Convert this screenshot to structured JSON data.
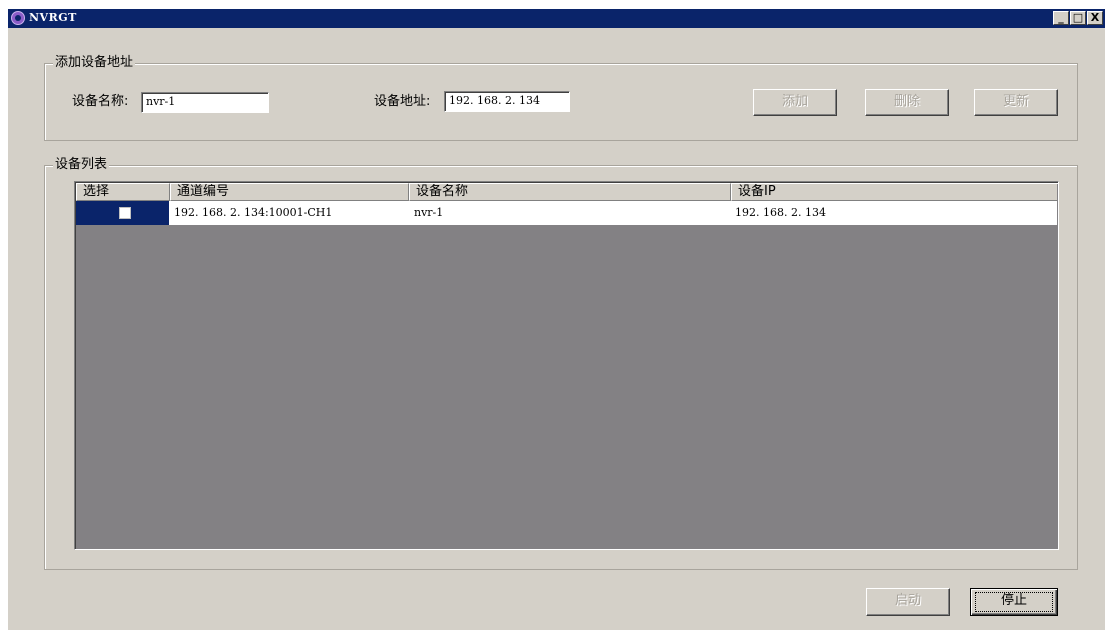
{
  "window": {
    "title": "NVRGT",
    "buttons": {
      "minimize": "_",
      "maximize": "□",
      "close": "X"
    }
  },
  "add_group": {
    "legend": "添加设备地址",
    "name_label": "设备名称:",
    "name_value": "nvr-1",
    "address_label": "设备地址:",
    "address_value": "192. 168. 2. 134",
    "add_label": "添加",
    "delete_label": "删除",
    "update_label": "更新"
  },
  "list_group": {
    "legend": "设备列表",
    "columns": [
      "选择",
      "通道编号",
      "设备名称",
      "设备IP"
    ],
    "rows": [
      {
        "checked": false,
        "channel": "192. 168. 2. 134:10001-CH1",
        "name": "nvr-1",
        "ip": "192. 168. 2. 134"
      }
    ]
  },
  "bottom": {
    "start_label": "启动",
    "stop_label": "停止"
  }
}
